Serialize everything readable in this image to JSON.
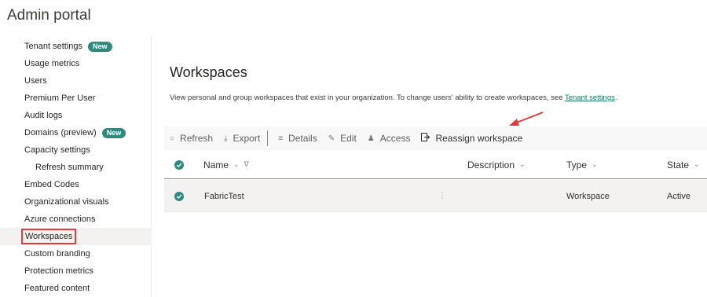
{
  "app": {
    "title": "Admin portal"
  },
  "sidebar": {
    "items": [
      {
        "label": "Tenant settings",
        "badge": "New"
      },
      {
        "label": "Usage metrics"
      },
      {
        "label": "Users"
      },
      {
        "label": "Premium Per User"
      },
      {
        "label": "Audit logs"
      },
      {
        "label": "Domains (preview)",
        "badge": "New"
      },
      {
        "label": "Capacity settings"
      },
      {
        "label": "Refresh summary"
      },
      {
        "label": "Embed Codes"
      },
      {
        "label": "Organizational visuals"
      },
      {
        "label": "Azure connections"
      },
      {
        "label": "Workspaces",
        "selected": true
      },
      {
        "label": "Custom branding"
      },
      {
        "label": "Protection metrics"
      },
      {
        "label": "Featured content"
      }
    ]
  },
  "main": {
    "title": "Workspaces",
    "description": "View personal and group workspaces that exist in your organization. To change users' ability to create workspaces, see ",
    "description_link": "Tenant settings",
    "description_end": "."
  },
  "toolbar": {
    "refresh": "Refresh",
    "export": "Export",
    "details": "Details",
    "edit": "Edit",
    "access": "Access",
    "reassign": "Reassign workspace"
  },
  "table": {
    "columns": {
      "name": "Name",
      "description": "Description",
      "type": "Type",
      "state": "State"
    },
    "rows": [
      {
        "name": "FabricTest",
        "description": "",
        "type": "Workspace",
        "state": "Active"
      }
    ]
  },
  "colors": {
    "accent": "#2e8a80",
    "highlight": "#e23c3c",
    "link": "#117865"
  }
}
